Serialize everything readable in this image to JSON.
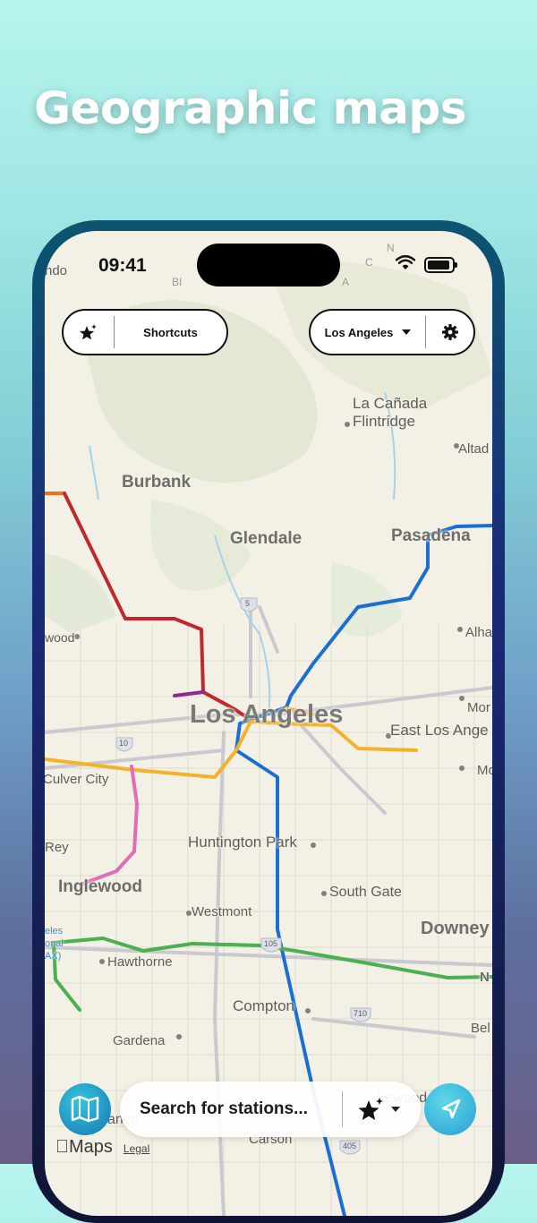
{
  "headline": "Geographic maps",
  "status_bar": {
    "time": "09:41"
  },
  "top_bar": {
    "shortcuts_label": "Shortcuts",
    "city_label": "Los Angeles",
    "icons": {
      "favorites": "star-sparkle-icon",
      "city_dropdown": "caret-down-icon",
      "settings": "gear-icon"
    }
  },
  "map": {
    "main_label": "Los Angeles",
    "places": {
      "la_canada_1": "La Cañada",
      "la_canada_2": "Flintridge",
      "altadena": "Altad",
      "burbank": "Burbank",
      "glendale": "Glendale",
      "pasadena": "Pasadena",
      "wood": "wood",
      "alhambra": "Alha",
      "monterey": "Mor",
      "east_la": "East Los Ange",
      "culver_city": "Culver City",
      "mont": "Mo",
      "huntington_park": "Huntington Park",
      "rey": "Rey",
      "inglewood": "Inglewood",
      "south_gate": "South Gate",
      "westmont": "Westmont",
      "downey": "Downey",
      "lax_1": "eles",
      "lax_2": "onal",
      "lax_3": "AX)",
      "hawthorne": "Hawthorne",
      "norwalk": "N",
      "compton": "Compton",
      "bell": "Bel",
      "gardena": "Gardena",
      "lakewood": "kewood",
      "carson": "Carson",
      "ance": "ance",
      "bi": "BI",
      "mtn_a": "A",
      "mtn_c": "C",
      "mtn_n": "N",
      "ndo": "ndo"
    },
    "highways": {
      "h5": "5",
      "h10": "10",
      "h105": "105",
      "h710": "710",
      "h405": "405"
    },
    "lines": [
      {
        "name": "Red",
        "color": "#c0282d"
      },
      {
        "name": "Purple",
        "color": "#8e2a8f"
      },
      {
        "name": "Blue",
        "color": "#1b6fd3"
      },
      {
        "name": "Gold",
        "color": "#f4b22a"
      },
      {
        "name": "Expo",
        "color": "#f4b22a"
      },
      {
        "name": "Pink",
        "color": "#e26db5"
      },
      {
        "name": "Green",
        "color": "#4caf50"
      },
      {
        "name": "Orange",
        "color": "#f2711f"
      }
    ]
  },
  "bottom_bar": {
    "search_placeholder": "Search for stations...",
    "maps_logo": "Maps",
    "legal": "Legal",
    "icons": {
      "maps": "folded-map-icon",
      "filter": "star-sparkle-icon",
      "location": "location-arrow-icon"
    }
  }
}
